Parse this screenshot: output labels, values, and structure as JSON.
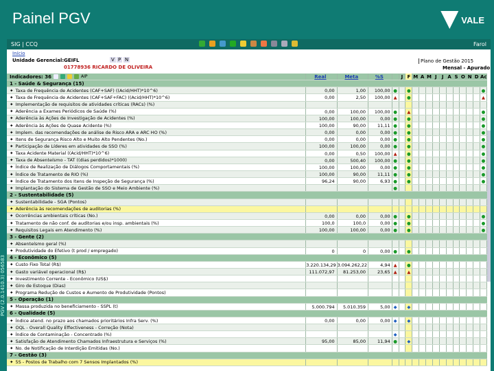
{
  "slide_title": "Painel PGV",
  "logo_text": "VALE",
  "side_text": "PGV (2.0.1410.3)  056583",
  "app": {
    "title": "SIG | CCQ",
    "farol": "Farol",
    "breadcrumb": "Início",
    "unit_label": "Unidade Gerencial:GEIFL",
    "nav": [
      "V",
      "P",
      "N"
    ],
    "user": "01778936  RICARDO DE OLIVEIRA",
    "plan": "Plano de Gestão 2015",
    "period": "Mensal - Apurado",
    "indicators": "Indicadores: 36",
    "aip": "AIP"
  },
  "columns": {
    "real": "Real",
    "meta": "Meta",
    "pct": "%S",
    "months": [
      "J",
      "F",
      "M",
      "A",
      "M",
      "J",
      "J",
      "A",
      "S",
      "O",
      "N",
      "D"
    ],
    "ac": "Ac"
  },
  "colors": {
    "teal": "#0f7b73",
    "section": "#9bc6a6",
    "highlight": "#fbf7a0",
    "green": "#1a9a2a",
    "red": "#b02010",
    "blue": "#2060c0"
  },
  "rows": [
    {
      "sec": "1 - Saúde & Segurança (15)"
    },
    {
      "l": "Taxa de Frequência de Acidentes (CAF+SAF) ((Acid/HHT)*10^6)",
      "r": "0,00",
      "m": "1,00",
      "p": "100,00",
      "s": "g",
      "f": "g",
      "a": "g"
    },
    {
      "l": "Taxa de Frequência de Acidentes (CAF+SAF+FAC) ((Acid/HHT)*10^6)",
      "r": "0,00",
      "m": "2,50",
      "p": "100,00",
      "s": "r",
      "f": "g",
      "a": "r"
    },
    {
      "l": "Implementação de requisitos de atividades críticas (RACs) (%)"
    },
    {
      "l": "Aderência a Exames Periódicos de Saúde (%)",
      "r": "0,00",
      "m": "100,00",
      "p": "100,00",
      "s": "g",
      "f": "r",
      "a": "g"
    },
    {
      "l": "Aderência às Ações de Investigação de Acidentes (%)",
      "r": "100,00",
      "m": "100,00",
      "p": "0,00",
      "s": "g",
      "f": "g",
      "a": "g"
    },
    {
      "l": "Aderência às Ações de Quase Acidente (%)",
      "r": "100,00",
      "m": "90,00",
      "p": "11,11",
      "s": "g",
      "f": "g",
      "a": "g"
    },
    {
      "l": "Implem. das recomendações de análise de Risco ARA e ARC HO (%)",
      "r": "0,00",
      "m": "0,00",
      "p": "0,00",
      "s": "g",
      "f": "g",
      "a": "g"
    },
    {
      "l": "Itens de Segurança Risco Alto e Muito Alto Pendentes (No.)",
      "r": "0,00",
      "m": "0,00",
      "p": "0,00",
      "s": "g",
      "f": "g",
      "a": "g"
    },
    {
      "l": "Participação de Líderes em atividades de SSO (%)",
      "r": "100,00",
      "m": "100,00",
      "p": "0,00",
      "s": "g",
      "f": "g",
      "a": "g"
    },
    {
      "l": "Taxa Acidente Material ((Acid/HHT)*10^6)",
      "r": "0,00",
      "m": "0,50",
      "p": "100,00",
      "s": "r",
      "f": "g",
      "a": "g"
    },
    {
      "l": "Taxa de Absenteísmo - TAT ((dias perdidos)*1000)",
      "r": "0,00",
      "m": "500,40",
      "p": "100,00",
      "s": "g",
      "f": "g",
      "a": "g"
    },
    {
      "l": "Índice de Realização de Diálogos Comportamentais (%)",
      "r": "100,00",
      "m": "100,00",
      "p": "0,00",
      "s": "g",
      "f": "g",
      "a": "g"
    },
    {
      "l": "Índice de Tratamento de RIO (%)",
      "r": "100,00",
      "m": "90,00",
      "p": "11,11",
      "s": "g",
      "f": "g",
      "a": "g"
    },
    {
      "l": "Índice de Tratamento dos Itens de Inspeção de Segurança (%)",
      "r": "96,24",
      "m": "90,00",
      "p": "6,93",
      "s": "g",
      "f": "g",
      "a": "g"
    },
    {
      "l": "Implantação do Sistema de Gestão de SSO e Meio Ambiente (%)",
      "s": "g"
    },
    {
      "sec": "2 - Sustentabilidade (5)"
    },
    {
      "l": "Sustentabilidade - SGA (Pontos)"
    },
    {
      "l": "Aderência às recomendações de auditorias (%)",
      "hl": true
    },
    {
      "l": "Ocorrências ambientais críticas (No.)",
      "r": "0,00",
      "m": "0,00",
      "p": "0,00",
      "s": "g",
      "f": "g",
      "a": "g"
    },
    {
      "l": "Tratamento de não conf. de auditorias e/ou insp. ambientais (%)",
      "r": "100,0",
      "m": "100,0",
      "p": "0,00",
      "s": "g",
      "f": "g",
      "a": "g"
    },
    {
      "l": "Requisitos Legais em Atendimento (%)",
      "r": "100,00",
      "m": "100,00",
      "p": "0,00",
      "s": "g",
      "f": "g",
      "a": "g"
    },
    {
      "sec": "3 - Gente (2)"
    },
    {
      "l": "Absenteísmo geral (%)"
    },
    {
      "l": "Produtividade do Efetivo (t prod / empregado)",
      "r": "0",
      "m": "0",
      "p": "0,00",
      "s": "g",
      "f": "g"
    },
    {
      "sec": "4 - Econômico (5)"
    },
    {
      "l": "Custo Fixo Total (R$)",
      "r": "3.220.134,29",
      "m": "3.094.262,22",
      "p": "4,94",
      "s": "r",
      "f": "g"
    },
    {
      "l": "Gasto variável operacional (R$)",
      "r": "111.072,97",
      "m": "81.253,00",
      "p": "23,65",
      "s": "r",
      "f": "r"
    },
    {
      "l": "Investimento Corrente - Econômico (US$)"
    },
    {
      "l": "Giro de Estoque (Dias)"
    },
    {
      "l": "Programa Redução de Custos e Aumento de Produtividade (Pontos)"
    },
    {
      "sec": "5 - Operação (1)"
    },
    {
      "l": "Massa produzida no beneficiamento - SSPL (t)",
      "r": "5.000.794",
      "m": "5.010.359",
      "p": "5,00",
      "s": "b",
      "f": "b"
    },
    {
      "sec": "6 - Qualidade (5)"
    },
    {
      "l": "Índice atend. no prazo aos chamados prioritários Infra Serv. (%)",
      "r": "0,00",
      "m": "0,00",
      "p": "0,00",
      "s": "b",
      "f": "b"
    },
    {
      "l": "OQL - Overall Quality Effectiveness - Correção (Nota)"
    },
    {
      "l": "Índice de Contaminação - Concentrado (%)",
      "s": "b"
    },
    {
      "l": "Satisfação de Atendimento Chamados Infraestrutura e Serviços (%)",
      "r": "95,00",
      "m": "85,00",
      "p": "11,94",
      "s": "g",
      "f": "b"
    },
    {
      "l": "No. de Notificação de Interdição Emitidas (No.)"
    },
    {
      "sec": "7 - Gestão (3)"
    },
    {
      "l": "5S - Postos de Trabalho com 7 Sensos Implantados (%)",
      "hl": true
    }
  ]
}
